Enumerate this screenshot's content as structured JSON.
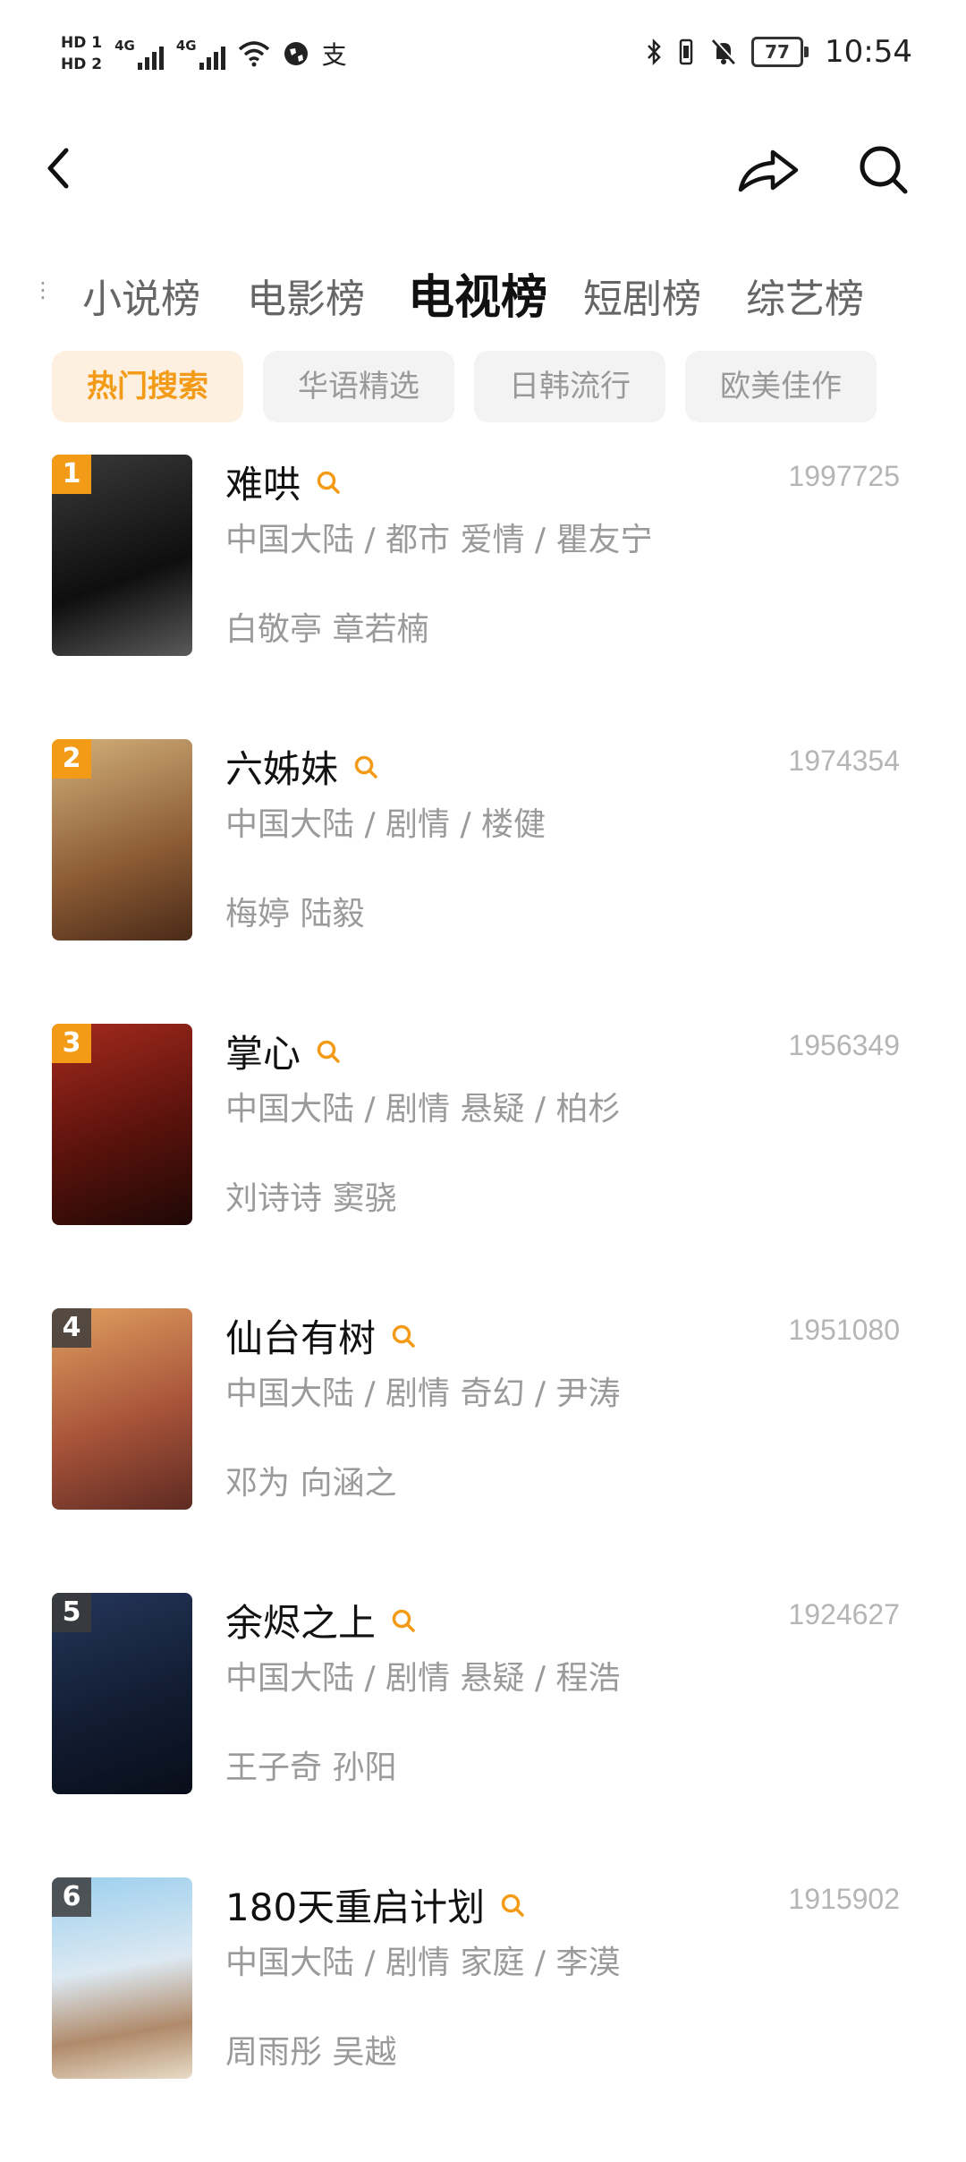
{
  "status_bar": {
    "hd1": "HD 1",
    "hd2": "HD 2",
    "sig1": "4G",
    "sig2": "4G",
    "battery": "77",
    "time": "10:54",
    "pay": "支"
  },
  "tabs": [
    "小说榜",
    "电影榜",
    "电视榜",
    "短剧榜",
    "综艺榜"
  ],
  "active_tab": "电视榜",
  "filters": [
    "热门搜索",
    "华语精选",
    "日韩流行",
    "欧美佳作"
  ],
  "active_filter": "热门搜索",
  "list": [
    {
      "rank": "1",
      "title": "难哄",
      "heat": "1997725",
      "meta": "中国大陆 / 都市 爱情 / 瞿友宁",
      "cast": "白敬亭 章若楠",
      "poster_colors": [
        "#2a2a2a",
        "#6b6b6b"
      ]
    },
    {
      "rank": "2",
      "title": "六姊妹",
      "heat": "1974354",
      "meta": "中国大陆 / 剧情 / 楼健",
      "cast": "梅婷 陆毅",
      "poster_colors": [
        "#c9a46a",
        "#7a4a2c"
      ]
    },
    {
      "rank": "3",
      "title": "掌心",
      "heat": "1956349",
      "meta": "中国大陆 / 剧情 悬疑 / 柏杉",
      "cast": "刘诗诗 窦骁",
      "poster_colors": [
        "#8a1a14",
        "#2b0d0a"
      ]
    },
    {
      "rank": "4",
      "title": "仙台有树",
      "heat": "1951080",
      "meta": "中国大陆 / 剧情 奇幻 / 尹涛",
      "cast": "邓为 向涵之",
      "poster_colors": [
        "#d08a4a",
        "#7a3a2a"
      ]
    },
    {
      "rank": "5",
      "title": "余烬之上",
      "heat": "1924627",
      "meta": "中国大陆 / 剧情 悬疑 / 程浩",
      "cast": "王子奇 孙阳",
      "poster_colors": [
        "#1e2c4a",
        "#0d1626"
      ]
    },
    {
      "rank": "6",
      "title": "180天重启计划",
      "heat": "1915902",
      "meta": "中国大陆 / 剧情 家庭 / 李漠",
      "cast": "周雨彤 吴越",
      "poster_colors": [
        "#8fc7e8",
        "#e9d9c1"
      ]
    }
  ],
  "colors": {
    "accent": "#f39b17",
    "muted": "#9a9a9a"
  }
}
